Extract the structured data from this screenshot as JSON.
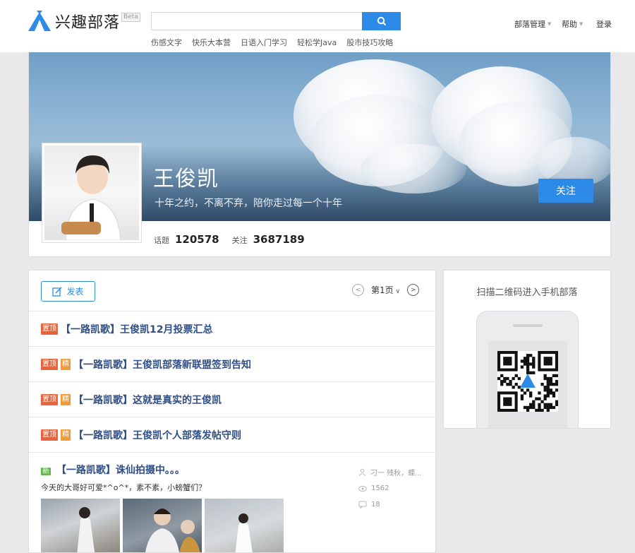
{
  "header": {
    "logo_text": "兴趣部落",
    "beta": "Beta",
    "search_placeholder": "",
    "hot_links": [
      "伤感文字",
      "快乐大本营",
      "日语入门学习",
      "轻松学Java",
      "股市技巧攻略"
    ],
    "nav": {
      "manage": "部落管理",
      "help": "帮助",
      "login": "登录"
    }
  },
  "tribe": {
    "name": "王俊凯",
    "motto": "十年之约，不离不弃，陪你走过每一个十年",
    "follow_label": "关注",
    "topics_label": "话题",
    "topics_count": "120578",
    "followers_label": "关注",
    "followers_count": "3687189"
  },
  "toolbar": {
    "post_label": "发表",
    "page_label": "第1页"
  },
  "posts": [
    {
      "tags": [
        "置顶"
      ],
      "title": "【一路凯歌】王俊凯12月投票汇总"
    },
    {
      "tags": [
        "置顶",
        "精"
      ],
      "title": "【一路凯歌】王俊凯部落新联盟签到告知"
    },
    {
      "tags": [
        "置顶",
        "精"
      ],
      "title": "【一路凯歌】这就是真实的王俊凯"
    },
    {
      "tags": [
        "置顶",
        "精"
      ],
      "title": "【一路凯歌】王俊凯个人部落发帖守则"
    }
  ],
  "feature_post": {
    "tag": "新",
    "title": "【一路凯歌】诛仙拍摄中。。。",
    "excerpt": "今天的大哥好可爱*^o^*，素不素，小螃蟹们？",
    "author": "刁一 残秋，蝶...",
    "views": "1562",
    "comments": "18"
  },
  "sidebar": {
    "qr_title": "扫描二维码进入手机部落"
  },
  "colors": {
    "accent": "#2d8ae6",
    "top_tag": "#e8643c",
    "jing_tag": "#f09c38",
    "new_tag": "#62b64c",
    "title_link": "#2f4f86"
  }
}
